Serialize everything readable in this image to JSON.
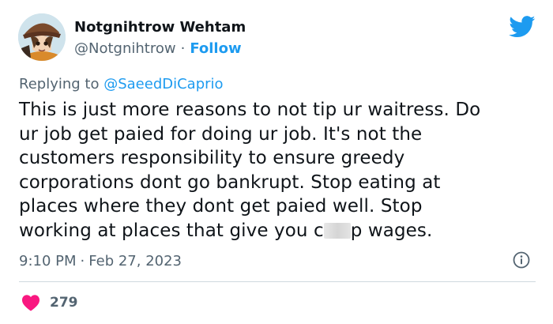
{
  "user": {
    "display_name": "Notgnihtrow Wehtam",
    "handle": "@Notgnihtrow",
    "separator": "·",
    "follow_label": "Follow"
  },
  "reply": {
    "prefix": "Replying to",
    "mention": "@SaeedDiCaprio"
  },
  "tweet": {
    "lines": [
      "This is just more reasons to not tip ur waitress. Do",
      "ur job get paied for doing ur job. It's not the",
      "customers responsibility to ensure greedy",
      "corporations dont go bankrupt. Stop eating at",
      "places where they dont get paied well. Stop"
    ],
    "last_line_before_blur": "working at places that give you c",
    "last_line_after_blur": "p wages."
  },
  "meta": {
    "time": "9:10 PM",
    "separator": "·",
    "date": "Feb 27, 2023"
  },
  "stats": {
    "likes": "279"
  },
  "icons": {
    "brand": "twitter-bird-icon",
    "info": "info-icon",
    "like": "heart-icon"
  },
  "colors": {
    "accent": "#1d9bf0",
    "secondary_text": "#536471",
    "like": "#f91880",
    "divider": "#cfd9de"
  }
}
